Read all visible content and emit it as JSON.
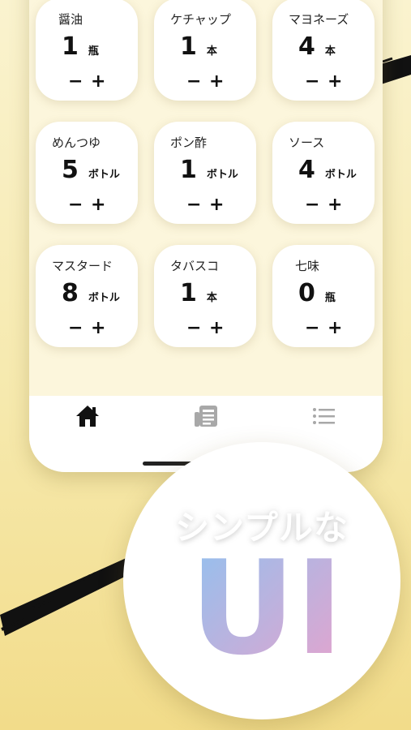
{
  "items": [
    {
      "name": "醤油",
      "qty": "1",
      "unit": "瓶",
      "minus": "−",
      "plus": "+"
    },
    {
      "name": "ケチャップ",
      "qty": "1",
      "unit": "本",
      "minus": "−",
      "plus": "+"
    },
    {
      "name": "マヨネーズ",
      "qty": "4",
      "unit": "本",
      "minus": "−",
      "plus": "+"
    },
    {
      "name": "めんつゆ",
      "qty": "5",
      "unit": "ボトル",
      "minus": "−",
      "plus": "+"
    },
    {
      "name": "ポン酢",
      "qty": "1",
      "unit": "ボトル",
      "minus": "−",
      "plus": "+"
    },
    {
      "name": "ソース",
      "qty": "4",
      "unit": "ボトル",
      "minus": "−",
      "plus": "+"
    },
    {
      "name": "マスタード",
      "qty": "8",
      "unit": "ボトル",
      "minus": "−",
      "plus": "+"
    },
    {
      "name": "タバスコ",
      "qty": "1",
      "unit": "本",
      "minus": "−",
      "plus": "+"
    },
    {
      "name": "七味",
      "qty": "0",
      "unit": "瓶",
      "minus": "−",
      "plus": "+"
    }
  ],
  "tabbar": {
    "icons": [
      "home-icon",
      "news-icon",
      "list-icon"
    ]
  },
  "promo": {
    "title": "シンプルな",
    "big_text": "UI",
    "gradient": [
      "#8fc2f0",
      "#e8a2cc"
    ]
  },
  "colors": {
    "background": "#f6e9ad",
    "card": "#ffffff",
    "text": "#111111"
  }
}
